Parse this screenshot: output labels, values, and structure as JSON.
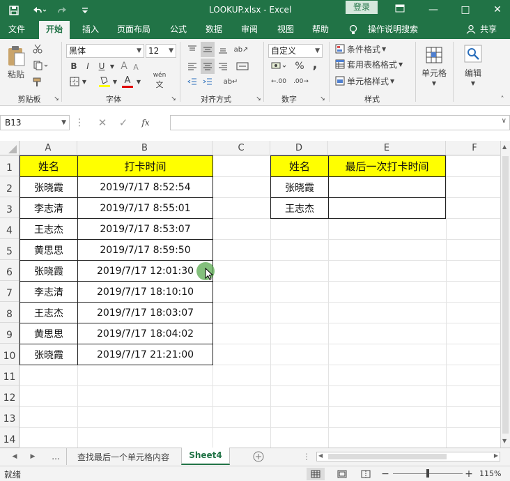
{
  "title_bar": {
    "title": "LOOKUP.xlsx  -  Excel",
    "login": "登录",
    "save_icon": "save-icon",
    "undo_icon": "undo-icon",
    "redo_icon": "redo-icon"
  },
  "tabs": [
    "文件",
    "开始",
    "插入",
    "页面布局",
    "公式",
    "数据",
    "审阅",
    "视图",
    "帮助"
  ],
  "active_tab": "开始",
  "tell_me": "操作说明搜索",
  "share": "共享",
  "ribbon": {
    "clipboard": {
      "paste": "粘贴",
      "label": "剪贴板"
    },
    "font": {
      "name": "黑体",
      "size": "12",
      "label": "字体",
      "bold": "B",
      "italic": "I",
      "underline": "U",
      "font_color": "A",
      "phonetic": "wén"
    },
    "alignment": {
      "label": "对齐方式"
    },
    "number": {
      "format": "自定义",
      "label": "数字",
      "percent": "%",
      "comma": ","
    },
    "styles": {
      "conditional": "条件格式",
      "table": "套用表格格式",
      "cell_styles": "单元格样式",
      "label": "样式"
    },
    "cells": {
      "label": "单元格"
    },
    "editing": {
      "label": "编辑"
    }
  },
  "formula_bar": {
    "name_box": "B13",
    "fx": "fx",
    "formula": ""
  },
  "columns": [
    "A",
    "B",
    "C",
    "D",
    "E",
    "F"
  ],
  "rows": [
    "1",
    "2",
    "3",
    "4",
    "5",
    "6",
    "7",
    "8",
    "9",
    "10",
    "11",
    "12",
    "13",
    "14"
  ],
  "table1": {
    "headers": [
      "姓名",
      "打卡时间"
    ],
    "rows": [
      [
        "张晓霞",
        "2019/7/17  8:52:54"
      ],
      [
        "李志清",
        "2019/7/17  8:55:01"
      ],
      [
        "王志杰",
        "2019/7/17  8:53:07"
      ],
      [
        "黄思思",
        "2019/7/17  8:59:50"
      ],
      [
        "张晓霞",
        "2019/7/17  12:01:30"
      ],
      [
        "李志清",
        "2019/7/17  18:10:10"
      ],
      [
        "王志杰",
        "2019/7/17  18:03:07"
      ],
      [
        "黄思思",
        "2019/7/17  18:04:02"
      ],
      [
        "张晓霞",
        "2019/7/17  21:21:00"
      ]
    ]
  },
  "table2": {
    "headers": [
      "姓名",
      "最后一次打卡时间"
    ],
    "rows": [
      [
        "张晓霞",
        ""
      ],
      [
        "王志杰",
        ""
      ]
    ]
  },
  "sheet_tabs": [
    "...",
    "查找最后一个单元格内容",
    "Sheet4"
  ],
  "active_sheet": "Sheet4",
  "status": {
    "ready": "就绪",
    "zoom": "115%"
  },
  "colors": {
    "excel_green": "#217346",
    "header_fill": "#ffff00"
  }
}
